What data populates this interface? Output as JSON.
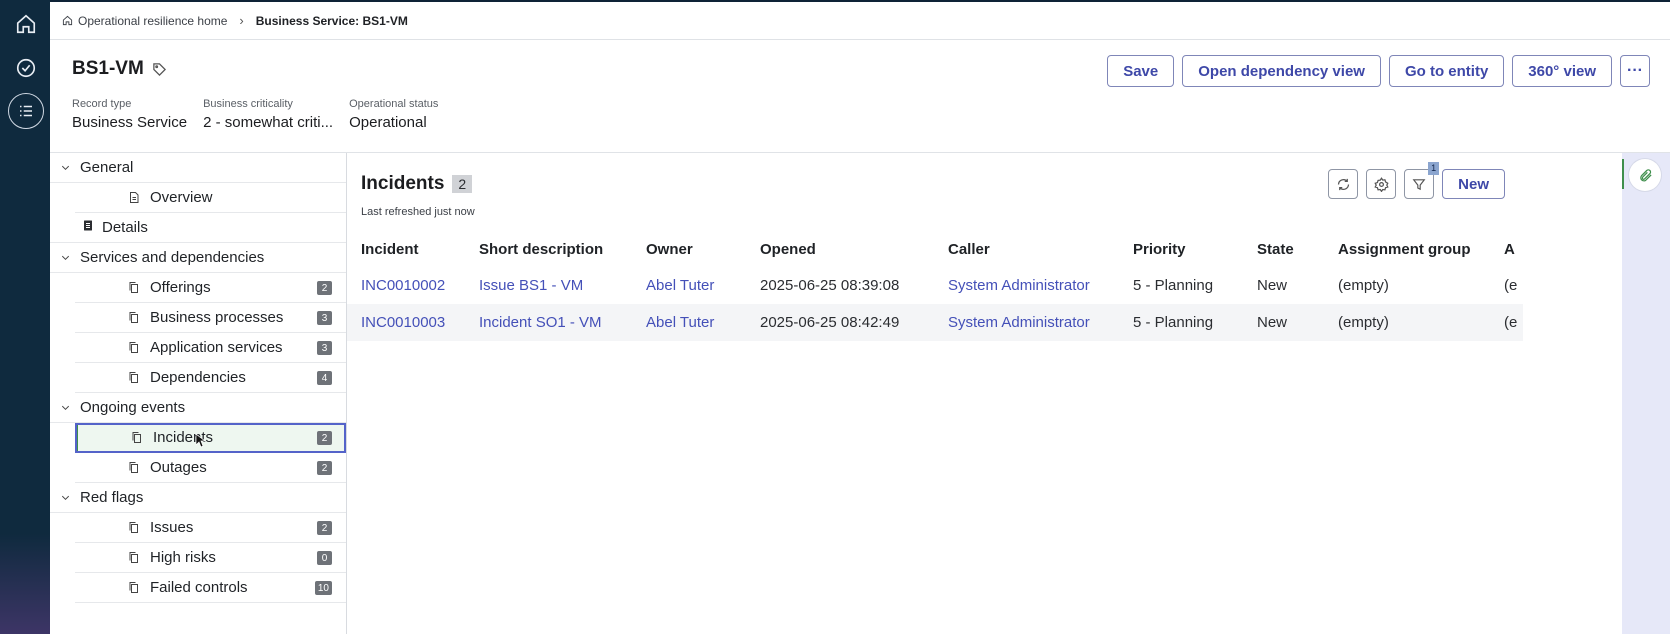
{
  "breadcrumb": {
    "home": "Operational resilience home",
    "current": "Business Service: BS1-VM"
  },
  "record": {
    "title": "BS1-VM",
    "fields": [
      {
        "label": "Record type",
        "value": "Business Service"
      },
      {
        "label": "Business criticality",
        "value": "2 - somewhat criti..."
      },
      {
        "label": "Operational status",
        "value": "Operational"
      }
    ]
  },
  "actions": {
    "save": "Save",
    "dependency": "Open dependency view",
    "entity": "Go to entity",
    "view360": "360° view",
    "more": "···"
  },
  "nav": {
    "general": {
      "label": "General",
      "overview": "Overview",
      "details": "Details"
    },
    "services": {
      "label": "Services and dependencies",
      "items": [
        {
          "label": "Offerings",
          "count": "2"
        },
        {
          "label": "Business processes",
          "count": "3"
        },
        {
          "label": "Application services",
          "count": "3"
        },
        {
          "label": "Dependencies",
          "count": "4"
        }
      ]
    },
    "ongoing": {
      "label": "Ongoing events",
      "items": [
        {
          "label": "Incidents",
          "count": "2"
        },
        {
          "label": "Outages",
          "count": "2"
        }
      ]
    },
    "redflags": {
      "label": "Red flags",
      "items": [
        {
          "label": "Issues",
          "count": "2"
        },
        {
          "label": "High risks",
          "count": "0"
        },
        {
          "label": "Failed controls",
          "count": "10"
        }
      ]
    }
  },
  "list": {
    "title": "Incidents",
    "count": "2",
    "refreshed": "Last refreshed just now",
    "filter_badge": "1",
    "new_label": "New",
    "columns": [
      "Incident",
      "Short description",
      "Owner",
      "Opened",
      "Caller",
      "Priority",
      "State",
      "Assignment group",
      "A"
    ],
    "rows": [
      {
        "incident": "INC0010002",
        "desc": "Issue BS1 - VM",
        "owner": "Abel Tuter",
        "opened": "2025-06-25 08:39:08",
        "caller": "System Administrator",
        "priority": "5 - Planning",
        "state": "New",
        "group": "(empty)",
        "extra": "(e"
      },
      {
        "incident": "INC0010003",
        "desc": "Incident SO1 - VM",
        "owner": "Abel Tuter",
        "opened": "2025-06-25 08:42:49",
        "caller": "System Administrator",
        "priority": "5 - Planning",
        "state": "New",
        "group": "(empty)",
        "extra": "(e"
      }
    ]
  },
  "colors": {
    "accent": "#3e48a8",
    "link": "#4450b8",
    "rail": "#0f2a3e",
    "selected_outline": "#5463c9"
  }
}
